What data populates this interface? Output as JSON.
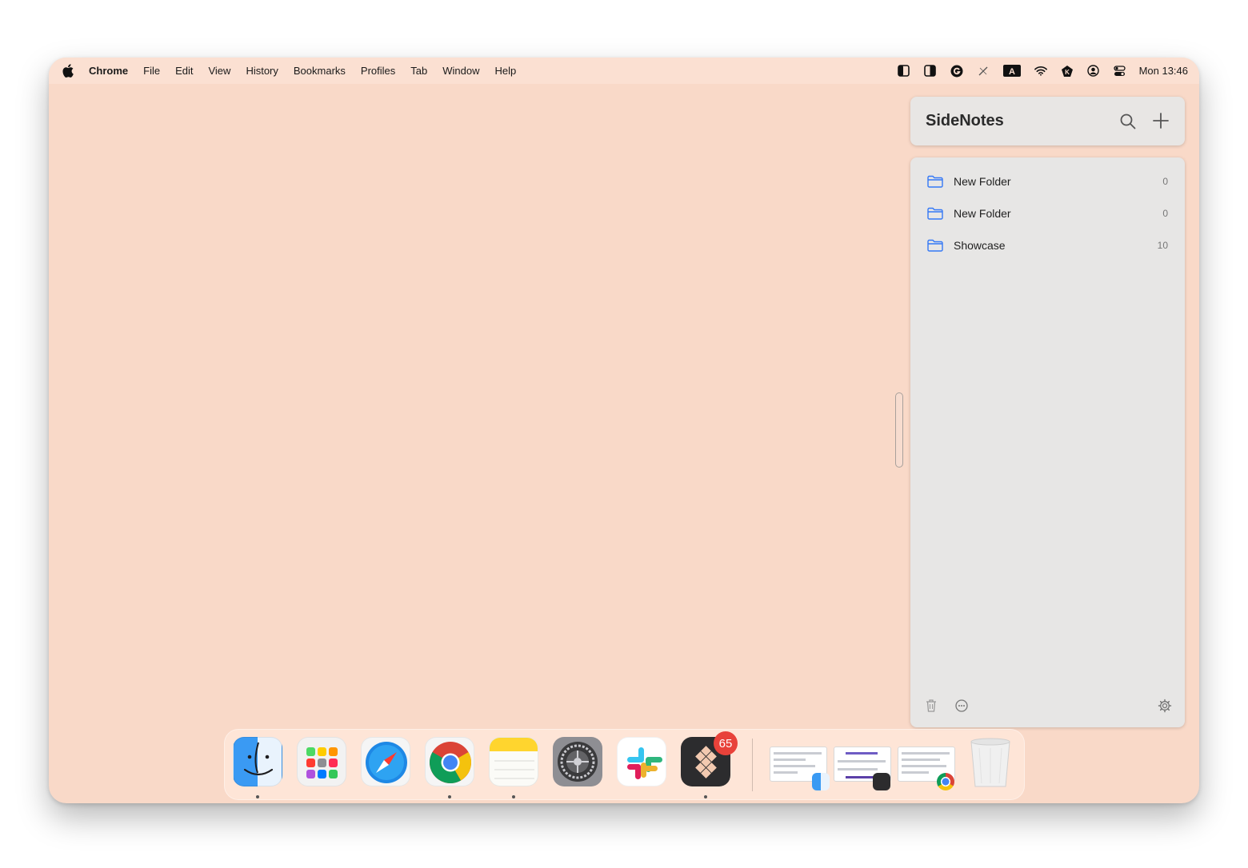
{
  "menubar": {
    "app_name": "Chrome",
    "items": [
      "File",
      "Edit",
      "View",
      "History",
      "Bookmarks",
      "Profiles",
      "Tab",
      "Window",
      "Help"
    ],
    "clock": "Mon 13:46",
    "tray_icons": [
      "sidebar-left-icon",
      "contrast-icon",
      "grammarly-icon",
      "pen-off-icon",
      "input-source-icon",
      "wifi-icon",
      "xnapper-icon",
      "user-account-icon",
      "control-center-icon"
    ],
    "input_source_label": "A"
  },
  "sidenotes": {
    "title": "SideNotes",
    "folders": [
      {
        "name": "New Folder",
        "count": "0"
      },
      {
        "name": "New Folder",
        "count": "0"
      },
      {
        "name": "Showcase",
        "count": "10"
      }
    ],
    "accent_color": "#3478f6"
  },
  "dock": {
    "apps": [
      "Finder",
      "Launchpad",
      "Safari",
      "Chrome",
      "Notes",
      "System Settings",
      "Slack",
      "SideNotes"
    ],
    "badge": "65",
    "recent_windows": [
      "Finder window",
      "SideNotes window",
      "Chrome window"
    ],
    "trash": "Trash"
  }
}
